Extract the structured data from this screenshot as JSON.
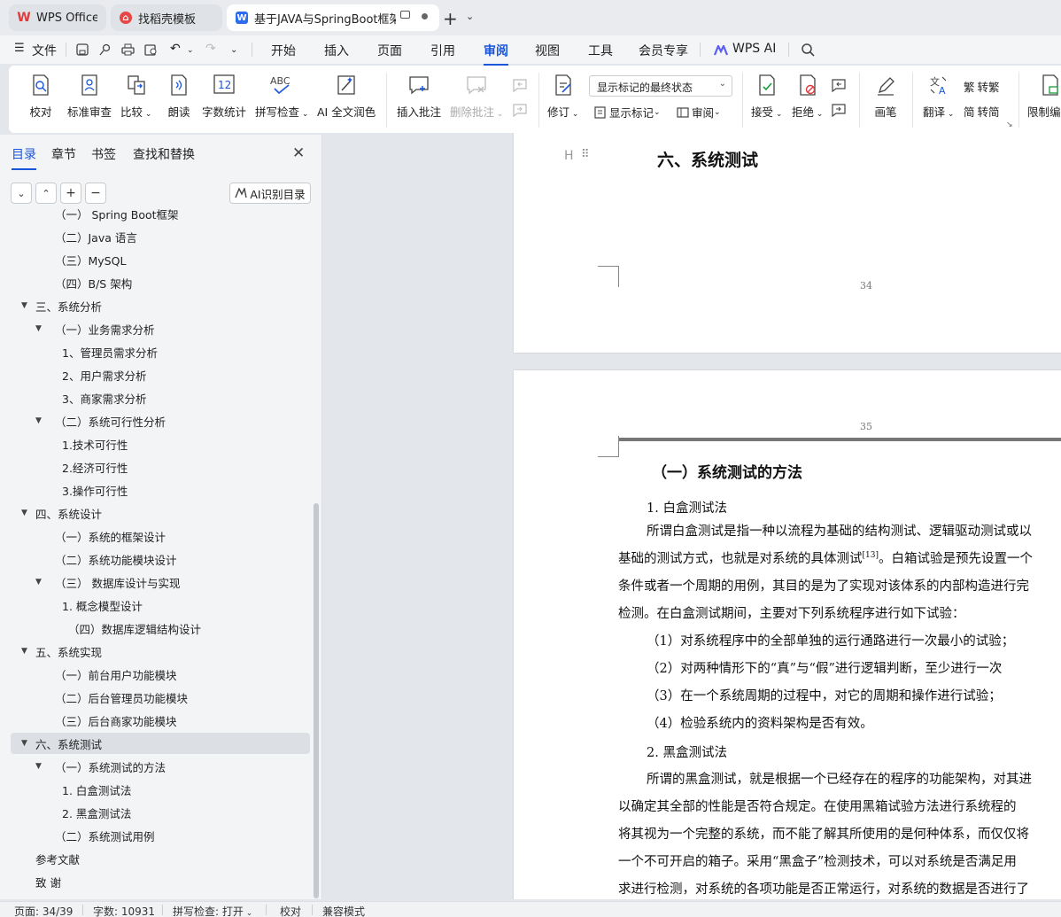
{
  "tabs": [
    {
      "label": "WPS Office",
      "icon": "wps-logo-icon"
    },
    {
      "label": "找稻壳模板",
      "icon": "docer-icon"
    },
    {
      "label": "基于JAVA与SpringBoot框架",
      "icon": "word-doc-icon"
    }
  ],
  "menu": {
    "file": "文件",
    "items": [
      "开始",
      "插入",
      "页面",
      "引用",
      "审阅",
      "视图",
      "工具",
      "会员专享"
    ],
    "active": "审阅",
    "wps_ai": "WPS AI"
  },
  "ribbon": {
    "proofread": "校对",
    "standard_review": "标准审查",
    "compare": "比较",
    "read_aloud": "朗读",
    "word_count": "字数统计",
    "word_count_icon_text": "12",
    "spell_check": "拼写检查",
    "spell_icon_text": "ABC",
    "ai_polish": "AI 全文润色",
    "insert_comment": "插入批注",
    "delete_comment": "删除批注",
    "track_changes": "修订",
    "markup_select": "显示标记的最终状态",
    "show_markup": "显示标记",
    "review_pane": "审阅",
    "accept": "接受",
    "reject": "拒绝",
    "pen": "画笔",
    "translate": "翻译",
    "to_traditional": "转繁",
    "to_simplified": "转简",
    "restrict_edit": "限制编"
  },
  "nav": {
    "tabs": [
      "目录",
      "章节",
      "书签",
      "查找和替换"
    ],
    "ai_toc": "AI识别目录",
    "toc": [
      {
        "label": "（一）   Spring Boot框架",
        "level": 2
      },
      {
        "label": "（二）Java 语言",
        "level": 2
      },
      {
        "label": "（三）MySQL",
        "level": 2
      },
      {
        "label": "（四）B/S 架构",
        "level": 2
      },
      {
        "label": "三、系统分析",
        "level": 1,
        "expanded": true
      },
      {
        "label": "（一）业务需求分析",
        "level": 2,
        "expanded": true
      },
      {
        "label": "1、管理员需求分析",
        "level": 3
      },
      {
        "label": "2、用户需求分析",
        "level": 3
      },
      {
        "label": "3、商家需求分析",
        "level": 3
      },
      {
        "label": "（二）系统可行性分析",
        "level": 2,
        "expanded": true
      },
      {
        "label": "1.技术可行性",
        "level": 3
      },
      {
        "label": "2.经济可行性",
        "level": 3
      },
      {
        "label": "3.操作可行性",
        "level": 3
      },
      {
        "label": "四、系统设计",
        "level": 1,
        "expanded": true
      },
      {
        "label": "（一）系统的框架设计",
        "level": 2
      },
      {
        "label": "（二）系统功能模块设计",
        "level": 2
      },
      {
        "label": "（三）   数据库设计与实现",
        "level": 2,
        "expanded": true
      },
      {
        "label": "1. 概念模型设计",
        "level": 3
      },
      {
        "label": "（四）数据库逻辑结构设计",
        "level": 3.3
      },
      {
        "label": "五、系统实现",
        "level": 1,
        "expanded": true
      },
      {
        "label": "（一）前台用户功能模块",
        "level": 2
      },
      {
        "label": "（二）后台管理员功能模块",
        "level": 2
      },
      {
        "label": "（三）后台商家功能模块",
        "level": 2
      },
      {
        "label": "六、系统测试",
        "level": 1,
        "expanded": true,
        "active": true
      },
      {
        "label": "（一）系统测试的方法",
        "level": 2,
        "expanded": true
      },
      {
        "label": "1. 白盒测试法",
        "level": 3
      },
      {
        "label": "2. 黑盒测试法",
        "level": 3
      },
      {
        "label": "（二）系统测试用例",
        "level": 2
      },
      {
        "label": "参考文献",
        "level": 0
      },
      {
        "label": "致      谢",
        "level": 0
      }
    ]
  },
  "doc": {
    "heading_marker": "H",
    "chapter_title": "六、系统测试",
    "page_num_1": "34",
    "page_num_2": "35",
    "section_title": "（一）系统测试的方法",
    "sub1": "1. 白盒测试法",
    "para1": [
      "所谓白盒测试是指一种以流程为基础的结构测试、逻辑驱动测试或以",
      "基础的测试方式，也就是对系统的具体测试",
      "。白箱试验是预先设置一个",
      "条件或者一个周期的用例，其目的是为了实现对该体系的内部构造进行完",
      "检测。在白盒测试期间，主要对下列系统程序进行如下试验："
    ],
    "citation": "[13]",
    "items": [
      "（1）对系统程序中的全部单独的运行通路进行一次最小的试验；",
      "（2）对两种情形下的“真”与“假”进行逻辑判断，至少进行一次",
      "（3）在一个系统周期的过程中，对它的周期和操作进行试验；",
      "（4）检验系统内的资料架构是否有效。"
    ],
    "sub2": "2. 黑盒测试法",
    "para2": [
      "所谓的黑盒测试，就是根据一个已经存在的程序的功能架构，对其进",
      "以确定其全部的性能是否符合规定。在使用黑箱试验方法进行系统程的",
      "将其视为一个完整的系统，而不能了解其所使用的是何种体系，而仅仅将",
      "一个不可开启的箱子。采用“黑盒子”检测技术，可以对系统是否满足用",
      "求进行检测，对系统的各项功能是否正常运行，对系统的数据是否进行了"
    ]
  },
  "status": {
    "page": "页面: 34/39",
    "words": "字数: 10931",
    "spell": "拼写检查: 打开",
    "proof": "校对",
    "compat": "兼容模式"
  },
  "colors": {
    "accent": "#1a56db",
    "wps_red": "#e03a3a",
    "word_blue": "#2b6cf0"
  }
}
